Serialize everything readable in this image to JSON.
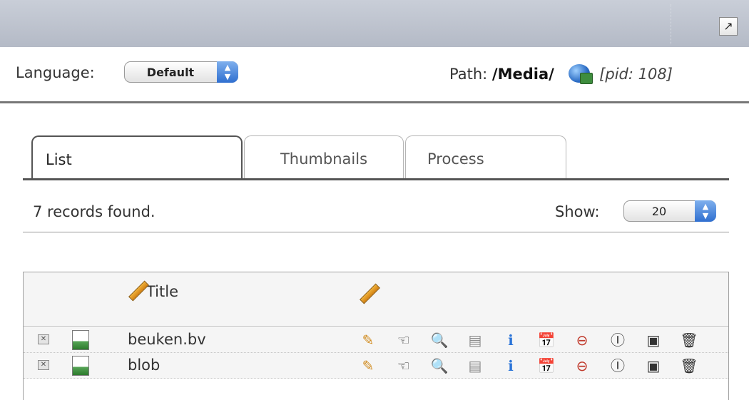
{
  "header": {
    "open_icon": "arrow-up-right-icon",
    "open_glyph": "↗"
  },
  "toolbar": {
    "language_label": "Language:",
    "language_value": "Default",
    "path_label": "Path:",
    "path_value": "/Media/",
    "path_icon": "globe-icon",
    "pid": "[pid: 108]"
  },
  "tabs": [
    {
      "label": "List",
      "active": true
    },
    {
      "label": "Thumbnails",
      "active": false
    },
    {
      "label": "Process",
      "active": false
    }
  ],
  "results": {
    "count_text": "7 records found.",
    "show_label": "Show:",
    "show_value": "20"
  },
  "table": {
    "columns": [
      {
        "label": "Title",
        "icon": "pencil-icon"
      },
      {
        "label": "",
        "icon": "pencil-icon"
      }
    ],
    "rows": [
      {
        "title": "beuken.bv"
      },
      {
        "title": "blob"
      }
    ],
    "row_actions": [
      {
        "icon": "pencil-icon",
        "glyph": "✎"
      },
      {
        "icon": "hand-pointer-icon",
        "glyph": "☜"
      },
      {
        "icon": "magnifier-icon",
        "glyph": "🔍"
      },
      {
        "icon": "document-grey-icon",
        "glyph": "▤"
      },
      {
        "icon": "info-icon",
        "glyph": "ℹ"
      },
      {
        "icon": "calendar-clock-icon",
        "glyph": "📅"
      },
      {
        "icon": "lightbulb-delete-icon",
        "glyph": "⊖"
      },
      {
        "icon": "text-cursor-icon",
        "glyph": "Ⓘ"
      },
      {
        "icon": "image-copy-icon",
        "glyph": "▣"
      },
      {
        "icon": "trash-icon",
        "glyph": "🗑"
      }
    ]
  },
  "colors": {
    "header_bg": "#b9bfca",
    "accent_blue": "#2f6fd0"
  }
}
